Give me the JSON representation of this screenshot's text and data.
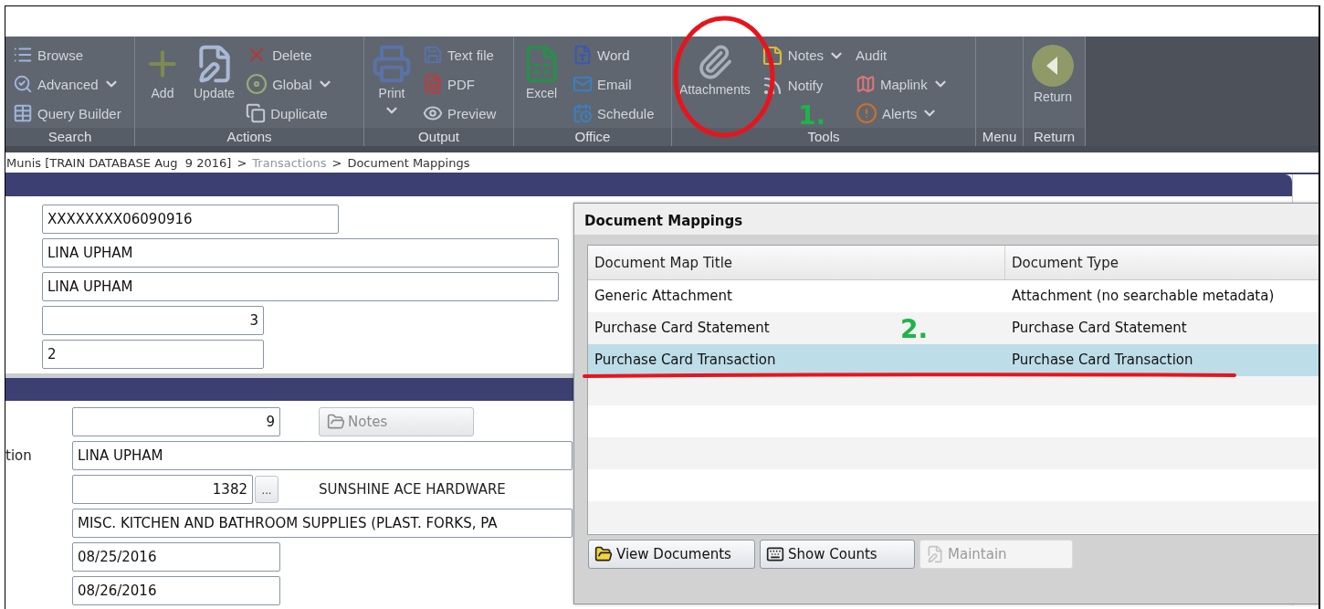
{
  "ribbon": {
    "groups": [
      {
        "label": "Search",
        "columns": [
          [
            {
              "label": "Browse",
              "kind": "small",
              "dropdown": false
            },
            {
              "label": "Advanced",
              "kind": "small",
              "dropdown": true
            },
            {
              "label": "Query Builder",
              "kind": "small",
              "dropdown": false
            }
          ]
        ]
      },
      {
        "label": "Actions",
        "columns": [
          [
            {
              "label": "Add",
              "kind": "large",
              "dropdown": false
            }
          ],
          [
            {
              "label": "Update",
              "kind": "large",
              "dropdown": false
            }
          ],
          [
            {
              "label": "Delete",
              "kind": "small",
              "dropdown": false
            },
            {
              "label": "Global",
              "kind": "small",
              "dropdown": true
            },
            {
              "label": "Duplicate",
              "kind": "small",
              "dropdown": false
            }
          ]
        ]
      },
      {
        "label": "Output",
        "columns": [
          [
            {
              "label": "Print",
              "kind": "large",
              "dropdown": true
            }
          ],
          [
            {
              "label": "Text file",
              "kind": "small",
              "dropdown": false
            },
            {
              "label": "PDF",
              "kind": "small",
              "dropdown": false
            },
            {
              "label": "Preview",
              "kind": "small",
              "dropdown": false
            }
          ]
        ]
      },
      {
        "label": "Office",
        "columns": [
          [
            {
              "label": "Excel",
              "kind": "large",
              "dropdown": false
            }
          ],
          [
            {
              "label": "Word",
              "kind": "small",
              "dropdown": false
            },
            {
              "label": "Email",
              "kind": "small",
              "dropdown": false
            },
            {
              "label": "Schedule",
              "kind": "small",
              "dropdown": false
            }
          ]
        ]
      },
      {
        "label": "Tools",
        "columns": [
          [
            {
              "label": "Attachments",
              "kind": "large",
              "dropdown": false
            }
          ],
          [
            {
              "label": "Notes",
              "kind": "small",
              "dropdown": true
            },
            {
              "label": "Notify",
              "kind": "small",
              "dropdown": false
            }
          ],
          [
            {
              "label": "Audit",
              "kind": "small",
              "dropdown": false
            },
            {
              "label": "Maplink",
              "kind": "small",
              "dropdown": true
            },
            {
              "label": "Alerts",
              "kind": "small",
              "dropdown": true
            }
          ]
        ]
      },
      {
        "label": "Menu"
      },
      {
        "label": "Return",
        "columns": [
          [
            {
              "label": "Return",
              "kind": "large",
              "dropdown": false
            }
          ]
        ]
      }
    ]
  },
  "breadcrumb": [
    {
      "label": "Munis [TRAIN DATABASE Aug  9 2016]",
      "kind": "root"
    },
    {
      "label": ">",
      "kind": "separator"
    },
    {
      "label": "Transactions",
      "kind": "link"
    },
    {
      "label": ">",
      "kind": "separator"
    },
    {
      "label": "Document Mappings",
      "kind": "current"
    }
  ],
  "form": {
    "header_fields": [
      {
        "value": "XXXXXXXX06090916",
        "kind": "text"
      },
      {
        "value": "LINA UPHAM",
        "kind": "text"
      },
      {
        "value": "LINA UPHAM",
        "kind": "text"
      },
      {
        "value": "3",
        "kind": "number"
      },
      {
        "value": "2",
        "kind": "text"
      }
    ],
    "detail_rows": [
      {
        "field": {
          "value": "9",
          "kind": "number"
        },
        "button": {
          "label": "Notes",
          "disabled": true
        }
      },
      {
        "label": "tion",
        "field": {
          "value": "LINA UPHAM",
          "kind": "text"
        }
      },
      {
        "field": {
          "value": "1382",
          "kind": "number"
        },
        "lookup": "...",
        "description": "SUNSHINE ACE HARDWARE"
      },
      {
        "field": {
          "value": "MISC. KITCHEN AND BATHROOM SUPPLIES (PLAST. FORKS, PA",
          "kind": "text"
        }
      },
      {
        "field": {
          "value": "08/25/2016",
          "kind": "text"
        }
      },
      {
        "field": {
          "value": "08/26/2016",
          "kind": "text"
        }
      }
    ]
  },
  "dialog": {
    "title": "Document Mappings",
    "columns": [
      "Document Map Title",
      "Document Type"
    ],
    "rows": [
      {
        "cells": [
          "Generic Attachment",
          "Attachment (no searchable metadata)"
        ],
        "selected": false
      },
      {
        "cells": [
          "Purchase Card Statement",
          "Purchase Card Statement"
        ],
        "selected": false
      },
      {
        "cells": [
          "Purchase Card Transaction",
          "Purchase Card Transaction"
        ],
        "selected": true
      }
    ],
    "buttons": [
      {
        "label": "View Documents",
        "disabled": false
      },
      {
        "label": "Show Counts",
        "disabled": false
      },
      {
        "label": "Maintain",
        "disabled": true
      }
    ]
  },
  "annotations": [
    {
      "kind": "circle"
    },
    {
      "kind": "number",
      "text": "1."
    },
    {
      "kind": "number",
      "text": "2."
    },
    {
      "kind": "underline"
    }
  ]
}
